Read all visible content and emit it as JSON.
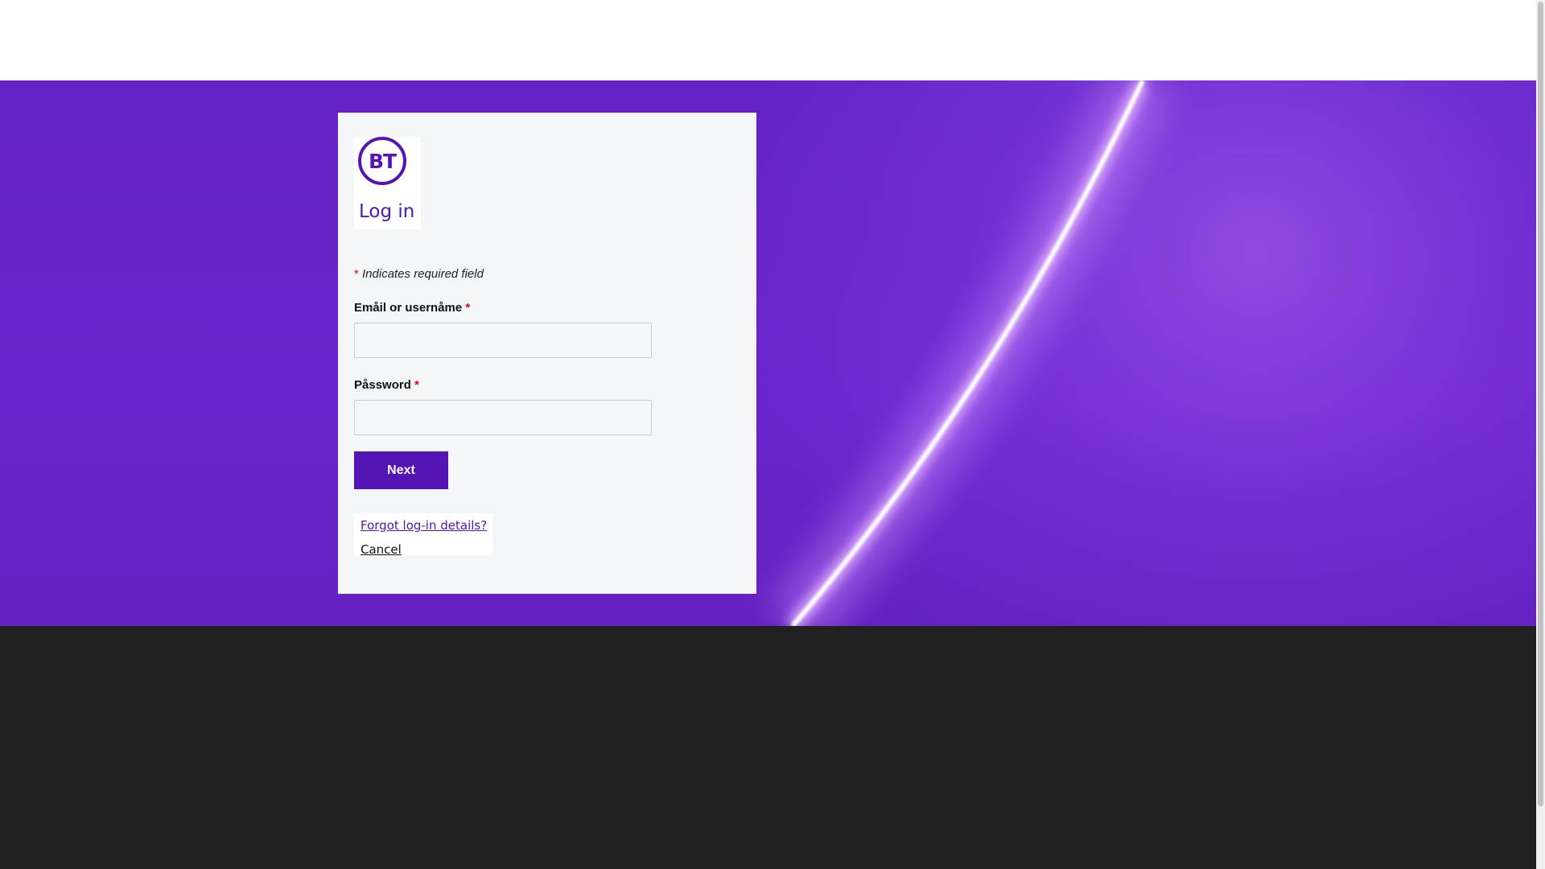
{
  "brand": {
    "logo_text": "BT",
    "accent_color": "#5514b4"
  },
  "login": {
    "title": "Log in",
    "required_star": "*",
    "required_note": "Indicates required field",
    "email_label": "Emåil or usernåme",
    "email_value": "",
    "password_label": "Påssword",
    "password_value": "",
    "next_label": "Next",
    "forgot_link": "Forgot log-in details?",
    "cancel_link": "Cancel"
  },
  "colors": {
    "hero_purple": "#6a24cc",
    "footer": "#212121",
    "required_star": "#e60014"
  }
}
